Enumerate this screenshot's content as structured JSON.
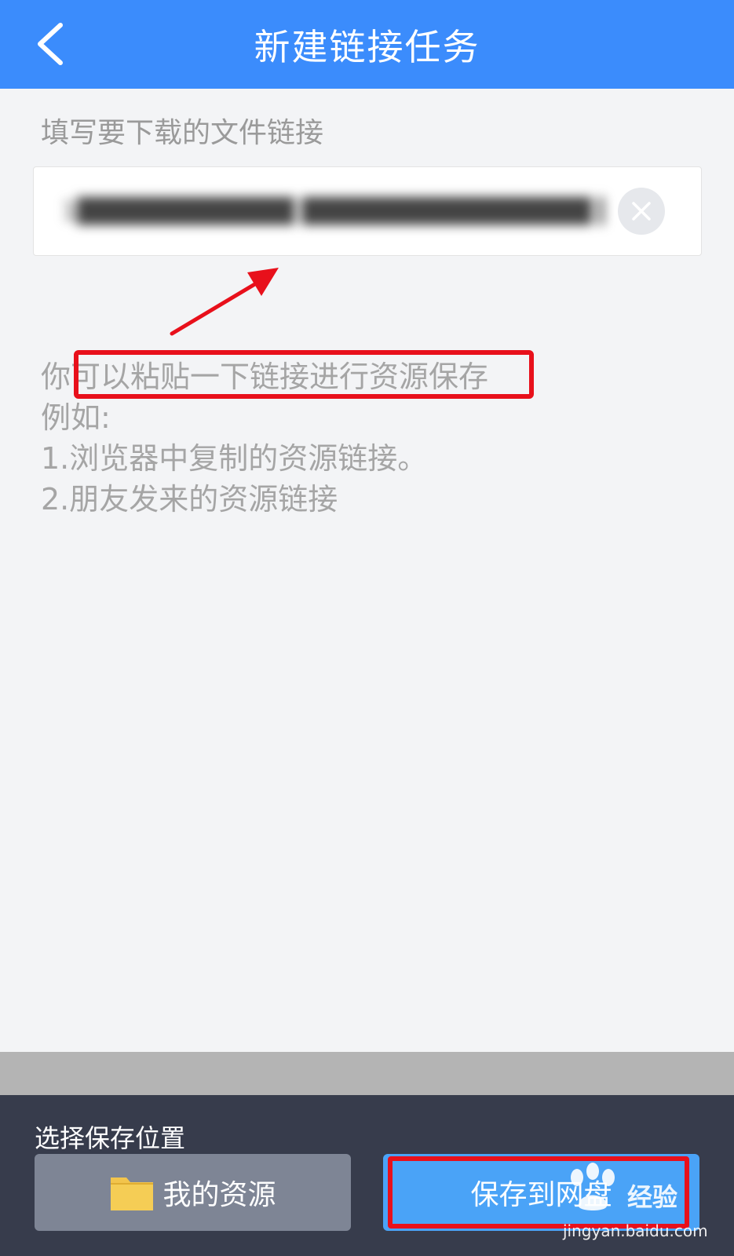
{
  "header": {
    "title": "新建链接任务"
  },
  "form": {
    "section_label": "填写要下载的文件链接",
    "url_value": "1████████████ ████████████████ ████████████5"
  },
  "hint": {
    "line1": "你可以粘贴一下链接进行资源保存",
    "line2": "例如:",
    "line3": "1.浏览器中复制的资源链接。",
    "line4": "2.朋友发来的资源链接"
  },
  "bottom": {
    "label": "选择保存位置",
    "my_resource_label": "我的资源",
    "save_label": "保存到网盘"
  },
  "watermark": {
    "brand": "经验",
    "url": "jingyan.baidu.com"
  },
  "colors": {
    "header_bg": "#3b8cfc",
    "bottom_bg": "#373c4c",
    "save_button": "#4aa3f7",
    "highlight": "#e8101b"
  },
  "icons": {
    "back": "chevron-left-icon",
    "clear": "close-icon",
    "folder": "folder-icon",
    "arrow": "arrow-annotation-icon"
  }
}
